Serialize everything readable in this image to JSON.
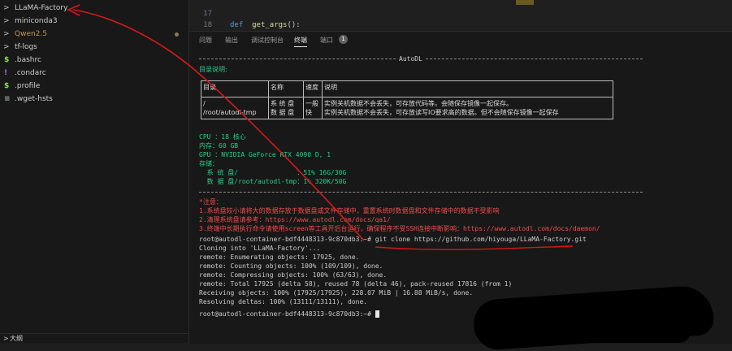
{
  "sidebar": {
    "items": [
      {
        "chevron": ">",
        "icon": "",
        "label": "LLaMA-Factory",
        "color": "#cccccc"
      },
      {
        "chevron": ">",
        "icon": "",
        "label": "miniconda3",
        "color": "#cccccc"
      },
      {
        "chevron": ">",
        "icon": "",
        "label": "Qwen2.5",
        "color": "#c09553"
      },
      {
        "chevron": ">",
        "icon": "",
        "label": "tf-logs",
        "color": "#cccccc"
      },
      {
        "chevron": "",
        "icon": "$",
        "label": ".bashrc",
        "color": "#cccccc"
      },
      {
        "chevron": "",
        "icon": "!",
        "label": ".condarc",
        "color": "#cccccc"
      },
      {
        "chevron": "",
        "icon": "$",
        "label": ".profile",
        "color": "#cccccc"
      },
      {
        "chevron": "",
        "icon": "≡",
        "label": ".wget-hsts",
        "color": "#cccccc"
      }
    ],
    "outline": {
      "chevron": ">",
      "label": "大纲"
    }
  },
  "editor": {
    "lines": [
      {
        "num": "17",
        "kw": "",
        "fn": "",
        "rest": ""
      },
      {
        "num": "18",
        "kw": "def",
        "fn": "get_args",
        "rest": "():"
      }
    ]
  },
  "panel": {
    "tabs": [
      "问题",
      "输出",
      "调试控制台",
      "终端",
      "端口"
    ],
    "active_tab": "终端",
    "ports_badge": "1"
  },
  "terminal": {
    "header_label": "AutoDL",
    "dir_title": "目录说明:",
    "table": {
      "headers": [
        "目录",
        "名称",
        "速度",
        "说明"
      ],
      "row": {
        "dirs": [
          "/",
          "/root/autodl-tmp"
        ],
        "names": [
          "系 统 盘",
          "数 据 盘"
        ],
        "speeds": [
          "一般",
          "快"
        ],
        "notes": [
          "实例关机数据不会丢失，可存放代码等。会随保存镜像一起保存。",
          "实例关机数据不会丢失，可存放读写IO要求高的数据。但不会随保存镜像一起保存"
        ]
      }
    },
    "sys_info": [
      "CPU ：18 核心",
      "内存：60 GB",
      "GPU ：NVIDIA GeForce RTX 4090 D, 1",
      "存储："
    ],
    "storage": [
      "  系 统 盘/               ：51% 16G/30G",
      "  数 据 盘/root/autodl-tmp：1% 320K/50G"
    ],
    "notes_title": "*注意：",
    "notes": [
      "1.系统盘较小请将大的数据存放于数据盘或文件存储中，重置系统时数据盘和文件存储中的数据不受影响",
      "2.清理系统盘请参考：https://www.autodl.com/docs/qa1/",
      "3.终端中长期执行命令请使用screen等工具开后台运行，确保程序不受SSH连接中断影响：https://www.autodl.com/docs/daemon/"
    ],
    "output": [
      "root@autodl-container-bdf4448313-9c870db3:~# git clone https://github.com/hiyouga/LLaMA-Factory.git",
      "Cloning into 'LLaMA-Factory'...",
      "remote: Enumerating objects: 17925, done.",
      "remote: Counting objects: 100% (109/109), done.",
      "remote: Compressing objects: 100% (63/63), done.",
      "remote: Total 17925 (delta 58), reused 78 (delta 46), pack-reused 17816 (from 1)",
      "Receiving objects: 100% (17925/17925), 228.07 MiB | 16.88 MiB/s, done.",
      "Resolving deltas: 100% (13111/13111), done."
    ],
    "prompt": "root@autodl-container-bdf4448313-9c870db3:~# "
  },
  "colors": {
    "annotation": "#d11a1a",
    "terminal_green": "#23d18b",
    "terminal_red": "#f14c4c"
  }
}
